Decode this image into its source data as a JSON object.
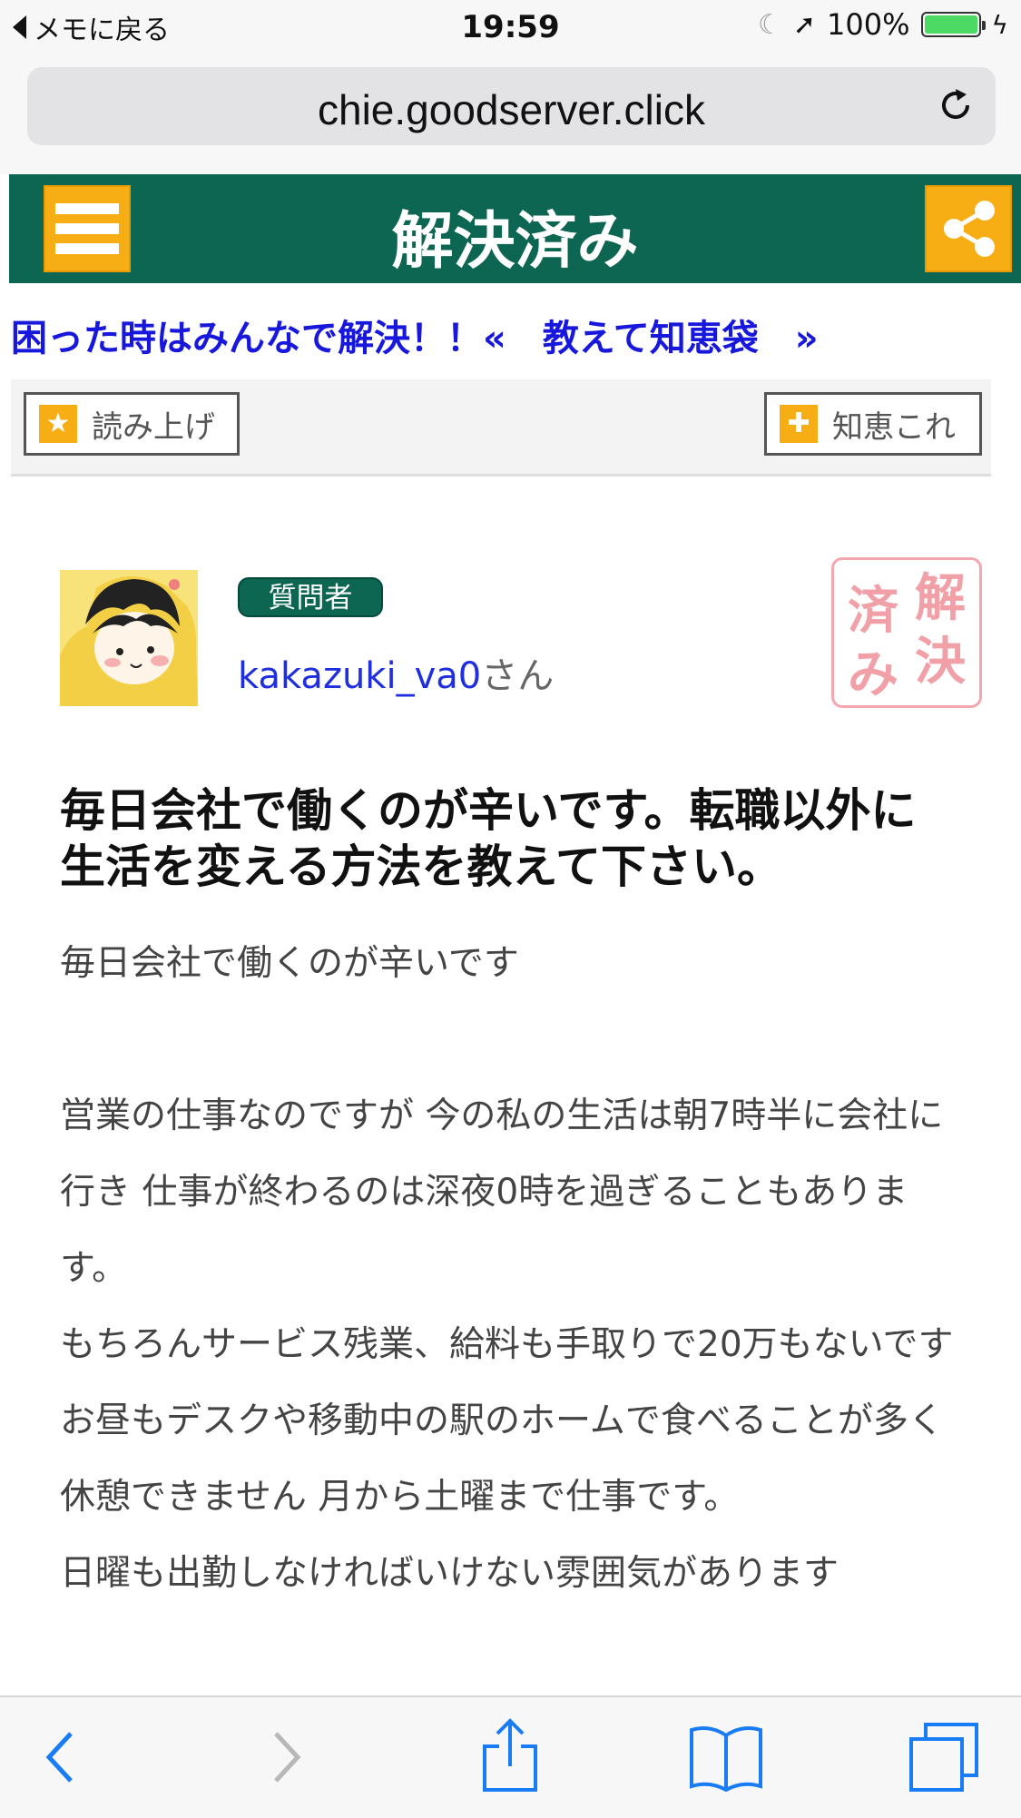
{
  "status_bar": {
    "back_label": "メモに戻る",
    "time": "19:59",
    "battery": "100%"
  },
  "browser": {
    "url": "chie.goodserver.click"
  },
  "header": {
    "title": "解決済み"
  },
  "tagline": {
    "text": "困った時はみんなで解決！！",
    "link_prefix": "« ",
    "link_label": "教えて知恵袋",
    "link_suffix": " »"
  },
  "toolbar": {
    "read_aloud_label": "読み上げ",
    "chie_kore_label": "知恵これ"
  },
  "question": {
    "asker_badge": "質問者",
    "asker_username": "kakazuki_va0",
    "asker_suffix": "さん",
    "stamp_col_right": "解決",
    "stamp_col_left": "済み",
    "title": "毎日会社で働くのが辛いです。転職以外に生活を変える方法を教えて下さい。",
    "body": [
      "毎日会社で働くのが辛いです",
      "",
      "営業の仕事なのですが 今の私の生活は朝7時半に会社に行き 仕事が終わるのは深夜0時を過ぎることもあります。",
      "もちろんサービス残業、給料も手取りで20万もないです",
      "お昼もデスクや移動中の駅のホームで食べることが多く休憩できません 月から土曜まで仕事です。",
      "日曜も出勤しなければいけない雰囲気があります"
    ]
  },
  "colors": {
    "header_green": "#0c6652",
    "accent_orange": "#f7ad14",
    "link_blue": "#1818dd",
    "stamp_pink": "#f09ba2"
  },
  "icons": {
    "bottom_bar": [
      "back-arrow-icon",
      "forward-arrow-icon",
      "share-icon",
      "bookmarks-icon",
      "tabs-icon"
    ]
  }
}
